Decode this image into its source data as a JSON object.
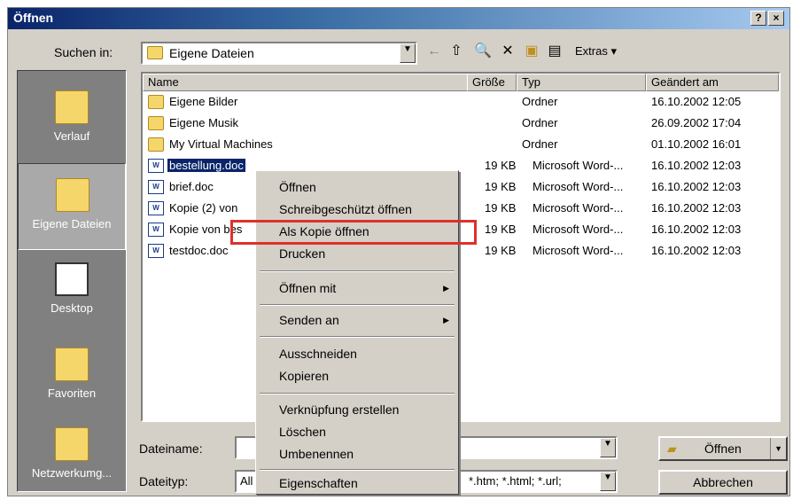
{
  "titlebar": {
    "title": "Öffnen",
    "help": "?",
    "close": "×"
  },
  "lookin": {
    "label": "Suchen in:",
    "value": "Eigene Dateien",
    "extras": "Extras ▾"
  },
  "places": [
    {
      "label": "Verlauf"
    },
    {
      "label": "Eigene Dateien"
    },
    {
      "label": "Desktop"
    },
    {
      "label": "Favoriten"
    },
    {
      "label": "Netzwerkumg..."
    }
  ],
  "columns": {
    "name": "Name",
    "size": "Größe",
    "type": "Typ",
    "modified": "Geändert am"
  },
  "files": [
    {
      "name": "Eigene Bilder",
      "size": "",
      "type": "Ordner",
      "modified": "16.10.2002 12:05",
      "kind": "folder"
    },
    {
      "name": "Eigene Musik",
      "size": "",
      "type": "Ordner",
      "modified": "26.09.2002 17:04",
      "kind": "folder"
    },
    {
      "name": "My Virtual Machines",
      "size": "",
      "type": "Ordner",
      "modified": "01.10.2002 16:01",
      "kind": "folder"
    },
    {
      "name": "bestellung.doc",
      "size": "19 KB",
      "type": "Microsoft Word-...",
      "modified": "16.10.2002 12:03",
      "kind": "doc"
    },
    {
      "name": "brief.doc",
      "size": "19 KB",
      "type": "Microsoft Word-...",
      "modified": "16.10.2002 12:03",
      "kind": "doc"
    },
    {
      "name": "Kopie (2) von",
      "size": "19 KB",
      "type": "Microsoft Word-...",
      "modified": "16.10.2002 12:03",
      "kind": "doc"
    },
    {
      "name": "Kopie von bes",
      "size": "19 KB",
      "type": "Microsoft Word-...",
      "modified": "16.10.2002 12:03",
      "kind": "doc"
    },
    {
      "name": "testdoc.doc",
      "size": "19 KB",
      "type": "Microsoft Word-...",
      "modified": "16.10.2002 12:03",
      "kind": "doc"
    }
  ],
  "context_menu": {
    "open": "Öffnen",
    "open_readonly": "Schreibgeschützt öffnen",
    "open_copy": "Als Kopie öffnen",
    "print": "Drucken",
    "open_with": "Öffnen mit",
    "send_to": "Senden an",
    "cut": "Ausschneiden",
    "copy": "Kopieren",
    "create_shortcut": "Verknüpfung erstellen",
    "delete": "Löschen",
    "rename": "Umbenennen",
    "properties": "Eigenschaften"
  },
  "filename": {
    "label": "Dateiname:",
    "value": ""
  },
  "filetype": {
    "label": "Dateityp:",
    "value_left": "All",
    "value_right": "*.htm; *.html; *.url;"
  },
  "buttons": {
    "open": "Öffnen",
    "cancel": "Abbrechen"
  },
  "colors": {
    "title_dark": "#0a246a",
    "highlight_box": "#e0302a",
    "face": "#d4d0c8"
  }
}
